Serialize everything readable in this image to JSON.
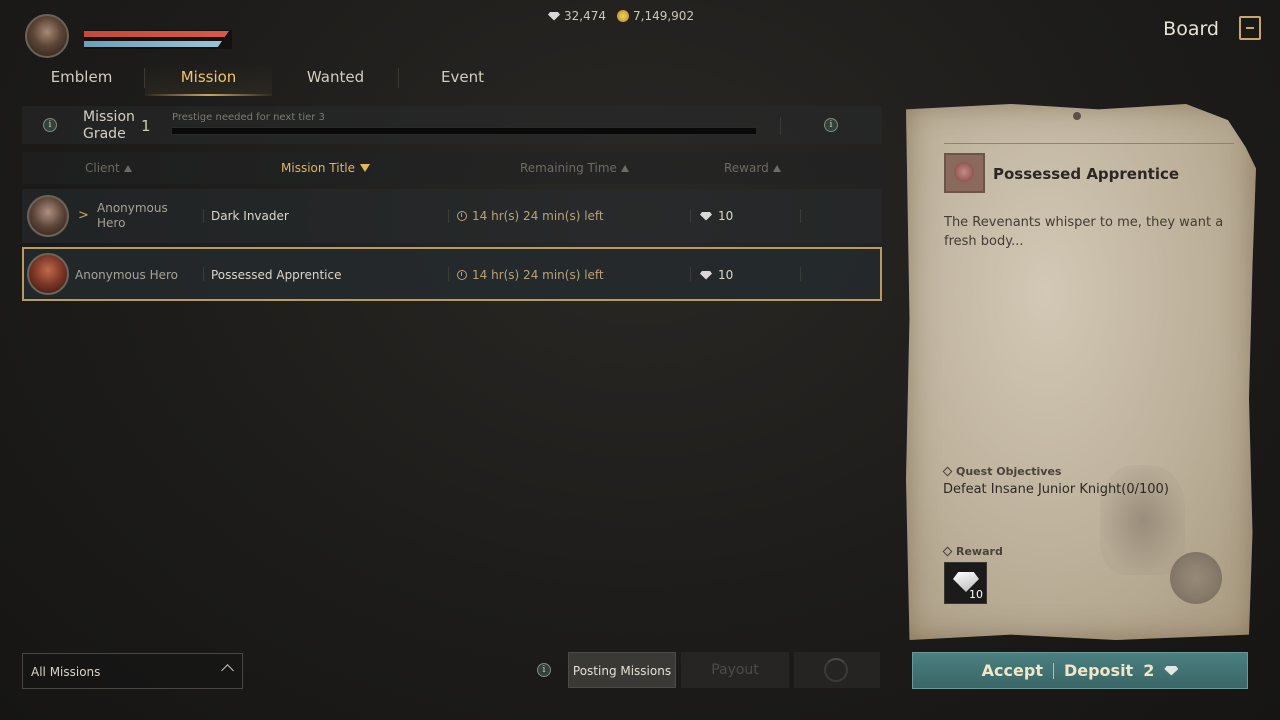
{
  "hud": {
    "gems": "32,474",
    "gold": "7,149,902",
    "board_title": "Board"
  },
  "tabs": [
    "Emblem",
    "Mission",
    "Wanted",
    "Event"
  ],
  "active_tab": "Mission",
  "grade": {
    "label": "Mission Grade",
    "value": "1",
    "prestige_label": "Prestige needed for next tier 3",
    "prestige_progress": 0
  },
  "table": {
    "headers": {
      "client": "Client",
      "title": "Mission Title",
      "time": "Remaining Time",
      "reward": "Reward"
    },
    "rows": [
      {
        "client": "Anonymous Hero",
        "title": "Dark Invader",
        "time": "14 hr(s) 24 min(s) left",
        "reward": "10"
      },
      {
        "client": "Anonymous Hero",
        "title": "Possessed Apprentice",
        "time": "14 hr(s) 24 min(s) left",
        "reward": "10"
      }
    ]
  },
  "filter": {
    "selected": "All Missions"
  },
  "buttons": {
    "posting": "Posting Missions",
    "payout": "Payout"
  },
  "detail": {
    "name": "Possessed Apprentice",
    "description": "The Revenants whisper to me, they want a fresh body...",
    "objectives_label": "Quest Objectives",
    "objective": "Defeat Insane Junior Knight(0/100)",
    "reward_label": "Reward",
    "reward_qty": "10"
  },
  "accept_bar": {
    "accept": "Accept",
    "deposit": "Deposit",
    "deposit_qty": "2"
  },
  "colors": {
    "accent_gold": "#e0b65e",
    "hp": "#c44a3a",
    "mp": "#9ac3d8",
    "accept_bg": "#3a6667"
  }
}
